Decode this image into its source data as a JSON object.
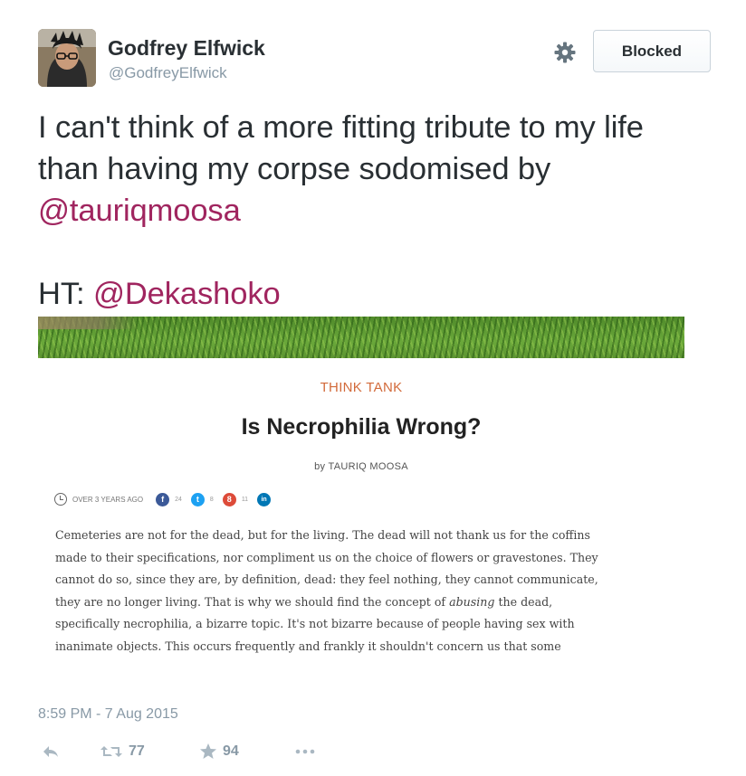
{
  "author": {
    "name": "Godfrey Elfwick",
    "handle": "@GodfreyElfwick"
  },
  "header": {
    "blocked_label": "Blocked",
    "settings_icon": "gear-icon"
  },
  "tweet": {
    "line1": "I can't think of a more fitting tribute to my life",
    "line2": "than having my corpse sodomised by",
    "mention1": "@tauriqmoosa",
    "ht_prefix": "HT: ",
    "mention2": "@Dekashoko",
    "mention_color": "#a0255f"
  },
  "media": {
    "kicker": "THINK TANK",
    "title": "Is Necrophilia Wrong?",
    "byline": "by TAURIQ MOOSA",
    "age": "OVER 3 YEARS AGO",
    "social": [
      {
        "icon": "facebook-icon",
        "glyph": "f",
        "count": "24",
        "color": "#3b5998"
      },
      {
        "icon": "twitter-icon",
        "glyph": "t",
        "count": "8",
        "color": "#1da1f2"
      },
      {
        "icon": "google-plus-icon",
        "glyph": "8",
        "count": "11",
        "color": "#dd4b39"
      },
      {
        "icon": "linkedin-icon",
        "glyph": "in",
        "count": "",
        "color": "#0077b5"
      }
    ],
    "excerpt": [
      "Cemeteries are not for the dead, but for the living. The dead will not thank us for the coffins",
      "made to their specifications, nor compliment us on the choice of flowers or gravestones. They",
      "cannot do so, since they are, by definition, dead: they feel nothing, they cannot communicate,",
      "they are no longer living. That is why we should find the concept of ",
      "abusing",
      " the dead,",
      "specifically necrophilia, a bizarre topic. It's not bizarre because of people having sex with",
      "inanimate objects. This occurs frequently and frankly it shouldn't concern us that some"
    ]
  },
  "footer": {
    "timestamp": "8:59 PM - 7 Aug 2015",
    "retweet_count": "77",
    "like_count": "94"
  }
}
